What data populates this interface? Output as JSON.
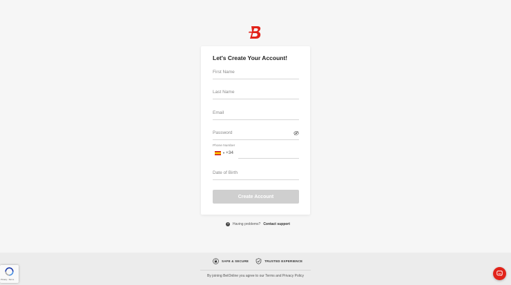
{
  "brand": {
    "accent_color": "#e2231a",
    "logo_icon": "betonline-b-logo-icon"
  },
  "form": {
    "title": "Let's Create Your Account!",
    "first_name_placeholder": "First Name",
    "last_name_placeholder": "Last Name",
    "email_placeholder": "Email",
    "password_placeholder": "Password",
    "password_toggle_icon": "eye-icon",
    "phone_label": "Phone Number",
    "phone_country_flag": "spain-flag-icon",
    "phone_dial_code": "+34",
    "dob_placeholder": "Date of Birth",
    "submit_label": "Create Account",
    "submit_color": "#cfcfcf"
  },
  "help": {
    "icon": "question-circle-icon",
    "text": "Having problems?",
    "link": "Contact support"
  },
  "footer": {
    "badges": [
      {
        "icon": "lock-icon",
        "label": "SAFE & SECURE"
      },
      {
        "icon": "shield-check-icon",
        "label": "TRUSTED EXPERIENCE"
      }
    ],
    "legal": "By joining BetOnline you agree to our Terms and Privacy Policy"
  },
  "recaptcha": {
    "icon": "recaptcha-icon",
    "text": "Privacy - Terms"
  },
  "chat": {
    "icon": "chat-bubble-icon"
  }
}
